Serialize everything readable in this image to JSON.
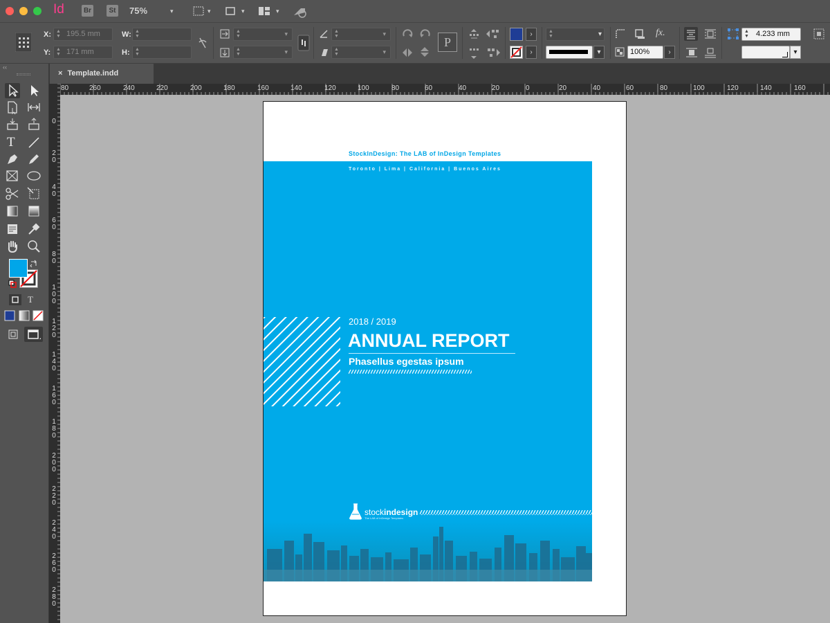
{
  "app": {
    "app_icon": "Id",
    "bridge_label": "Br",
    "stock_label": "St",
    "zoom": "75%",
    "colors": {
      "chrome": "#535353",
      "accent_blue": "#00aae9",
      "ruler": "#2e2e2e",
      "pasteboard": "#b3b3b3"
    }
  },
  "control_bar": {
    "x_label": "X:",
    "x_value": "195.5 mm",
    "y_label": "Y:",
    "y_value": "171 mm",
    "w_label": "W:",
    "h_label": "H:",
    "opacity": "100%",
    "stroke_weight": "4.233 mm",
    "fx_label": "fx."
  },
  "document": {
    "tab_title": "Template.indd",
    "close_icon": "×"
  },
  "rulers": {
    "horizontal": [
      "80",
      "260",
      "240",
      "220",
      "200",
      "180",
      "160",
      "140",
      "120",
      "100",
      "80",
      "60",
      "40",
      "20",
      "0",
      "20",
      "40",
      "60",
      "80",
      "100",
      "120",
      "140",
      "160"
    ],
    "vertical": [
      "0",
      "2\n0",
      "4\n0",
      "6\n0",
      "8\n0",
      "1\n0\n0",
      "1\n2\n0",
      "1\n4\n0",
      "1\n6\n0",
      "1\n8\n0",
      "2\n0\n0",
      "2\n2\n0",
      "2\n4\n0",
      "2\n6\n0",
      "2\n8\n0"
    ]
  },
  "cover": {
    "brand_line": "StockInDesign: The LAB of InDesign Templates",
    "cities": "Toronto | Lima | California | Buenos Aires",
    "year": "2018 / 2019",
    "title": "ANNUAL REPORT",
    "subtitle": "Phasellus egestas ipsum",
    "logo_prefix": "stock",
    "logo_suffix": "indesign",
    "logo_tagline": "The LAB of InDesign Templates"
  }
}
